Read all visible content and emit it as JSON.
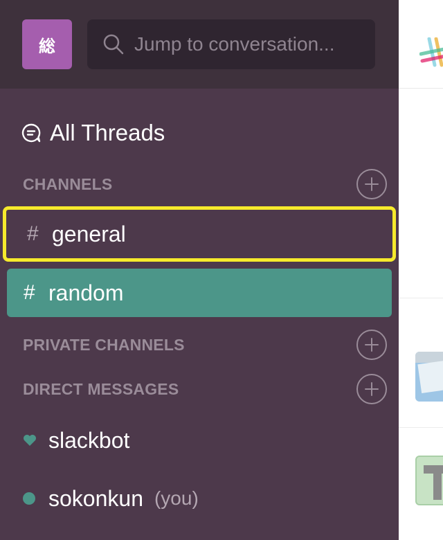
{
  "sidebar": {
    "team_initial": "総",
    "search": {
      "placeholder": "Jump to conversation..."
    },
    "all_threads_label": "All Threads",
    "sections": {
      "channels": {
        "title": "CHANNELS"
      },
      "private_channels": {
        "title": "PRIVATE CHANNELS"
      },
      "direct_messages": {
        "title": "DIRECT MESSAGES"
      }
    },
    "channels": [
      {
        "hash": "#",
        "name": "general",
        "highlighted": true
      },
      {
        "hash": "#",
        "name": "random",
        "selected": true
      }
    ],
    "direct_messages": [
      {
        "name": "slackbot",
        "icon": "heart-icon"
      },
      {
        "name": "sokonkun",
        "suffix": "(you)",
        "icon": "presence-dot-icon"
      }
    ]
  },
  "colors": {
    "sidebar_bg": "#4d394b",
    "topbar_bg": "#3e313c",
    "team_icon_bg": "#a55eae",
    "selected_channel_bg": "#4c9689",
    "highlight_border": "#f6ea2c",
    "muted_text": "#9a8c99"
  }
}
